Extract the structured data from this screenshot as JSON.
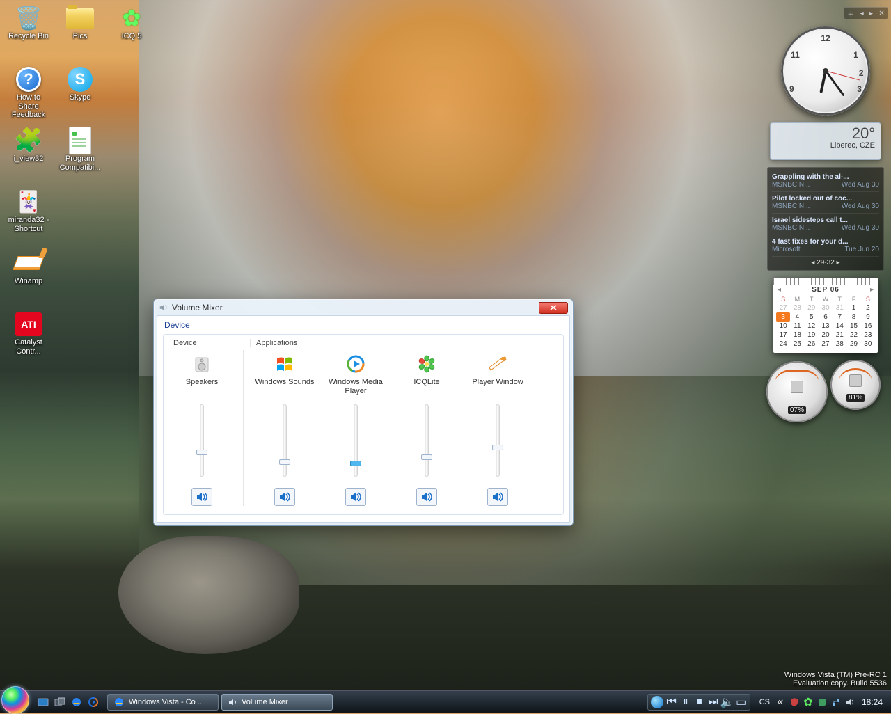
{
  "desktop": {
    "icons": [
      {
        "label": "Recycle Bin",
        "kind": "recycle"
      },
      {
        "label": "Pics",
        "kind": "folder"
      },
      {
        "label": "ICQ 5",
        "kind": "icq"
      },
      {
        "label": "How to Share Feedback",
        "kind": "help"
      },
      {
        "label": "Skype",
        "kind": "skype"
      },
      {
        "label": "i_view32",
        "kind": "puzzle"
      },
      {
        "label": "Program Compatibi...",
        "kind": "doc"
      },
      {
        "label": "miranda32 - Shortcut",
        "kind": "miranda"
      },
      {
        "label": "Winamp",
        "kind": "winamp"
      },
      {
        "label": "Catalyst Contr...",
        "kind": "ati"
      }
    ]
  },
  "mixer": {
    "title": "Volume Mixer",
    "section": "Device",
    "group_device": "Device",
    "group_apps": "Applications",
    "columns": [
      {
        "name": "Speakers",
        "icon": "speakers",
        "level": 32,
        "blue": false
      },
      {
        "name": "Windows Sounds",
        "icon": "winlogo",
        "level": 18,
        "blue": false
      },
      {
        "name": "Windows Media Player",
        "icon": "wmp",
        "level": 16,
        "blue": true
      },
      {
        "name": "ICQLite",
        "icon": "icq",
        "level": 25,
        "blue": false
      },
      {
        "name": "Player Window",
        "icon": "winamp",
        "level": 40,
        "blue": false
      }
    ]
  },
  "clock": {
    "hour": 6,
    "minute": 24
  },
  "weather": {
    "temp": "20°",
    "loc": "Liberec, CZE"
  },
  "feed": {
    "items": [
      {
        "title": "Grappling with the al-...",
        "src": "MSNBC N...",
        "date": "Wed Aug 30"
      },
      {
        "title": "Pilot locked out of coc...",
        "src": "MSNBC N...",
        "date": "Wed Aug 30"
      },
      {
        "title": "Israel sidesteps call t...",
        "src": "MSNBC N...",
        "date": "Wed Aug 30"
      },
      {
        "title": "4 fast fixes for your d...",
        "src": "Microsoft...",
        "date": "Tue Jun 20"
      }
    ],
    "pager": "29-32"
  },
  "calendar": {
    "header": "SEP 06",
    "dow": [
      "S",
      "M",
      "T",
      "W",
      "T",
      "F",
      "S"
    ],
    "leading": [
      27,
      28,
      29,
      30,
      31
    ],
    "days": 30,
    "today": 3
  },
  "meters": {
    "g1": "07%",
    "g2": "81%"
  },
  "watermark": {
    "l1": "Windows Vista (TM) Pre-RC 1",
    "l2": "Evaluation copy. Build 5536"
  },
  "taskbar": {
    "buttons": [
      {
        "label": "Windows Vista - Co ...",
        "icon": "ie",
        "active": false
      },
      {
        "label": "Volume Mixer",
        "icon": "vol",
        "active": true
      }
    ],
    "lang": "CS",
    "time": "18:24",
    "arrow": "«"
  }
}
